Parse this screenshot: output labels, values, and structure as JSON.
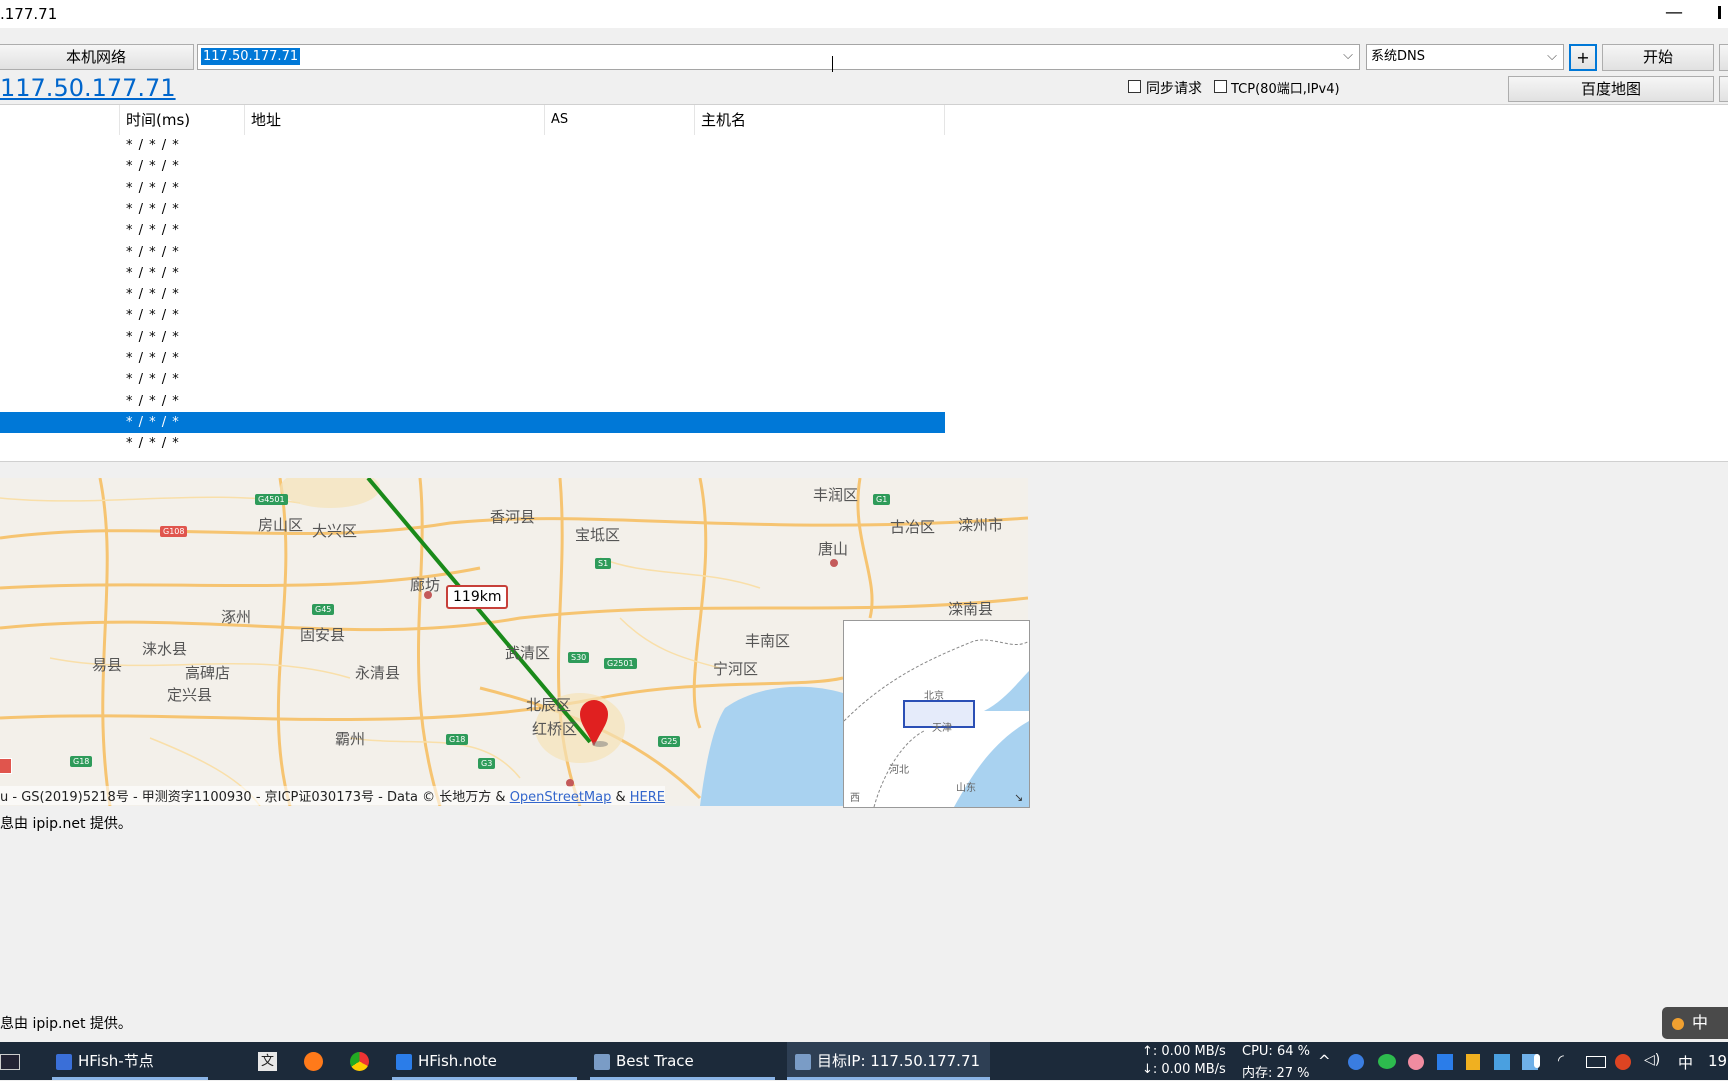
{
  "window": {
    "title": ".177.71",
    "minimize_glyph": "—"
  },
  "toolbar": {
    "local_network_label": "本机网络",
    "target_value": "117.50.177.71",
    "dns_value": "系统DNS",
    "plus_label": "+",
    "start_label": "开始"
  },
  "row2": {
    "ip_link": "117.50.177.71",
    "sync_label": "同步请求",
    "tcp_label": "TCP(80端口,IPv4)",
    "baidu_map_label": "百度地图"
  },
  "table": {
    "columns": [
      "时间(ms)",
      "地址",
      "AS",
      "主机名"
    ],
    "rows": [
      "* / * / *",
      "* / * / *",
      "* / * / *",
      "* / * / *",
      "* / * / *",
      "* / * / *",
      "* / * / *",
      "* / * / *",
      "* / * / *",
      "* / * / *",
      "* / * / *",
      "* / * / *",
      "* / * / *",
      "* / * / *",
      "* / * / *"
    ],
    "selected_index": 13
  },
  "map": {
    "places": [
      "丰润区",
      "古冶区",
      "滦州市",
      "房山区",
      "大兴区",
      "香河县",
      "宝坻区",
      "唐山",
      "廊坊",
      "涿州",
      "固安县",
      "滦南县",
      "涞水县",
      "易县",
      "高碑店",
      "定兴县",
      "永清县",
      "武清区",
      "丰南区",
      "宁河区",
      "北辰区",
      "红桥区",
      "霸州"
    ],
    "roads": [
      "G4501",
      "G108",
      "G45",
      "G1",
      "S1",
      "S30",
      "G2501",
      "G18",
      "G3",
      "G25",
      "G18"
    ],
    "distance_label": "119km",
    "inset_labels": [
      "北京",
      "天津",
      "河北",
      "山东",
      "西"
    ],
    "copyright_text": "u - GS(2019)5218号 - 甲测资字1100930 - 京ICP证030173号 - Data © 长地万方 & ",
    "copyright_link1": "OpenStreetMap",
    "copyright_amp": " & ",
    "copyright_link2": "HERE",
    "route_color": "#1a8a1a",
    "marker_color": "#e02020"
  },
  "info": {
    "line1": "息由 ipip.net 提供。",
    "line2": "息由 ipip.net 提供。"
  },
  "ime": {
    "label": "中"
  },
  "taskbar": {
    "items": [
      {
        "label": "HFish-节点"
      },
      {
        "label": "HFish.note"
      },
      {
        "label": "Best Trace"
      },
      {
        "label": "目标IP: 117.50.177.71"
      }
    ],
    "net_up": "↑: 0.00 MB/s",
    "net_down": "↓: 0.00 MB/s",
    "cpu": "CPU: 64 %",
    "mem": "内存: 27 %",
    "lang": "中",
    "clock_partial": "19"
  }
}
